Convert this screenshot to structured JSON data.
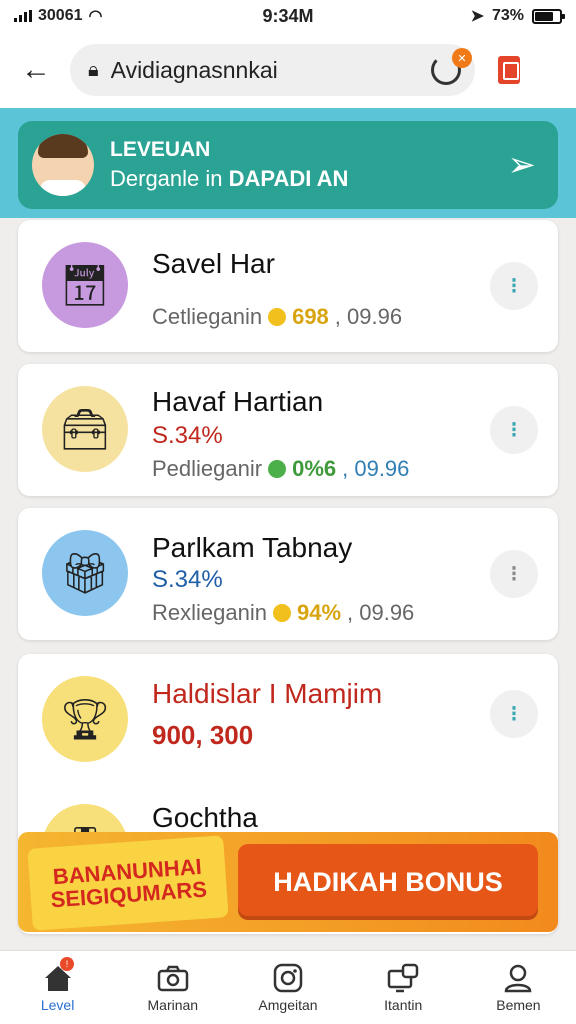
{
  "status": {
    "carrier": "30061",
    "time": "9:34M",
    "battery": "73%"
  },
  "browser": {
    "url": "Avidiagnasnnkai"
  },
  "banner": {
    "title": "LEVEUAN",
    "subtitle": "Derganle in",
    "highlight": "DAPADI AN"
  },
  "cards": [
    {
      "title": "Savel Har",
      "value": "",
      "meta_label": "Cetlieganin",
      "amount": "698",
      "extra": ", 09.96"
    },
    {
      "title": "Havaf Hartian",
      "value": "S.34%",
      "meta_label": "Pedlieganir",
      "amount": "0%6",
      "extra": ", 09.96"
    },
    {
      "title": "Parlkam Tabnay",
      "value": "S.34%",
      "meta_label": "Rexlieganin",
      "amount": "94%",
      "extra": ", 09.96"
    },
    {
      "title": "Haldislar I Mamjim",
      "value": "900, 300",
      "meta_label": "",
      "amount": "",
      "extra": ""
    },
    {
      "title": "Gochtha",
      "value": "",
      "meta_label": "",
      "amount": "",
      "extra": ""
    }
  ],
  "promo": {
    "badge": "BANANUNHAI SEIGIQUMARS",
    "button": "HADIKAH BONUS"
  },
  "tabs": [
    {
      "label": "Level"
    },
    {
      "label": "Marinan"
    },
    {
      "label": "Amgeitan"
    },
    {
      "label": "Itantin"
    },
    {
      "label": "Bemen"
    }
  ],
  "colors": {
    "teal": "#2aa394",
    "accent": "#f07a18",
    "red": "#c0281d",
    "link": "#2a6fd1"
  }
}
